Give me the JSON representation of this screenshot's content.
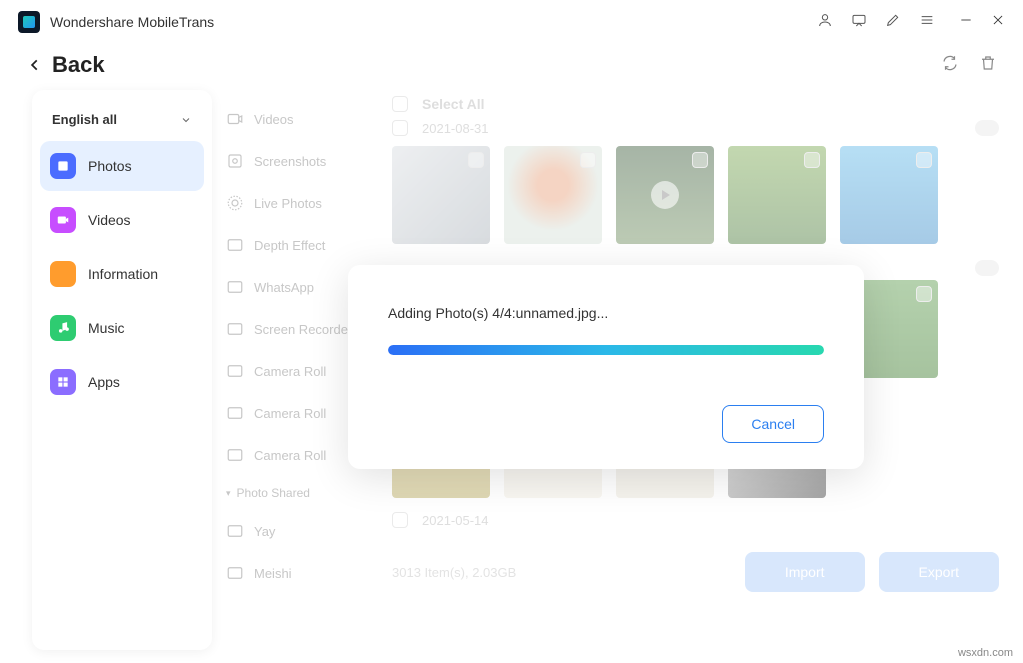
{
  "app": {
    "title": "Wondershare MobileTrans"
  },
  "back": "Back",
  "language": "English all",
  "categories": [
    {
      "label": "Photos",
      "icon": "photos",
      "active": true
    },
    {
      "label": "Videos",
      "icon": "videos",
      "active": false
    },
    {
      "label": "Information",
      "icon": "info",
      "active": false
    },
    {
      "label": "Music",
      "icon": "music",
      "active": false
    },
    {
      "label": "Apps",
      "icon": "apps",
      "active": false
    }
  ],
  "albums": {
    "items": [
      "Videos",
      "Screenshots",
      "Live Photos",
      "Depth Effect",
      "WhatsApp",
      "Screen Recorder",
      "Camera Roll",
      "Camera Roll",
      "Camera Roll"
    ],
    "section": "Photo Shared",
    "shared": [
      "Yay",
      "Meishi"
    ]
  },
  "content": {
    "select_all": "Select All",
    "dates": [
      "2021-08-31",
      "2021-05-14"
    ],
    "summary": "3013 Item(s), 2.03GB"
  },
  "buttons": {
    "import": "Import",
    "export": "Export"
  },
  "modal": {
    "message": "Adding Photo(s) 4/4:unnamed.jpg...",
    "progress_pct": 100,
    "cancel": "Cancel"
  },
  "watermark": "wsxdn.com"
}
